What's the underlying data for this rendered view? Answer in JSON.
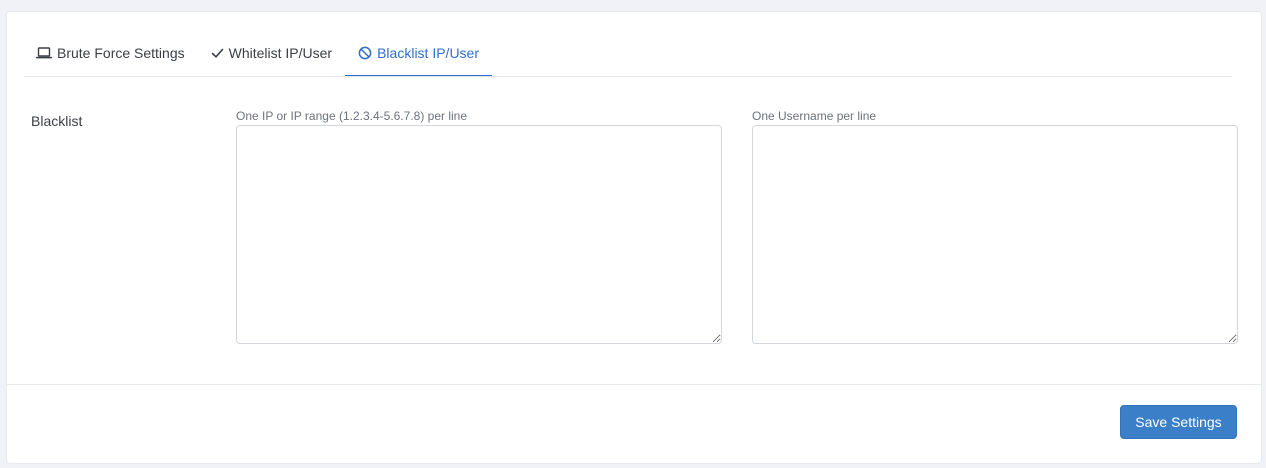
{
  "tabs": [
    {
      "label": "Brute Force Settings",
      "icon": "laptop-icon",
      "active": false
    },
    {
      "label": "Whitelist IP/User",
      "icon": "check-icon",
      "active": false
    },
    {
      "label": "Blacklist IP/User",
      "icon": "ban-icon",
      "active": true
    }
  ],
  "form": {
    "row_label": "Blacklist",
    "ip_field": {
      "hint": "One IP or IP range (1.2.3.4-5.6.7.8) per line",
      "value": ""
    },
    "username_field": {
      "hint": "One Username per line",
      "value": ""
    }
  },
  "footer": {
    "save_label": "Save Settings"
  },
  "colors": {
    "accent": "#2f6fcb",
    "button": "#3a7fc8",
    "background": "#f1f2f7"
  }
}
